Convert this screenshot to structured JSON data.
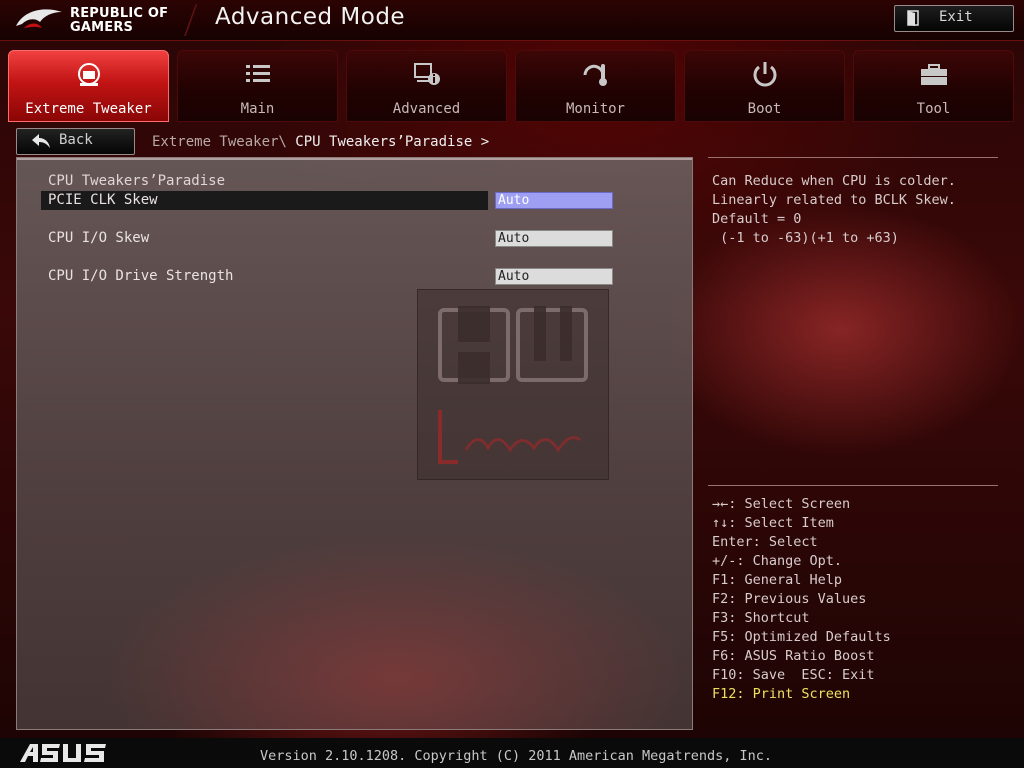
{
  "header": {
    "brand_line1": "REPUBLIC OF",
    "brand_line2": "GAMERS",
    "title": "Advanced Mode",
    "exit_label": "Exit"
  },
  "tabs": [
    {
      "label": "Extreme Tweaker",
      "icon": "tweaker-icon",
      "active": true
    },
    {
      "label": "Main",
      "icon": "list-icon",
      "active": false
    },
    {
      "label": "Advanced",
      "icon": "advanced-icon",
      "active": false
    },
    {
      "label": "Monitor",
      "icon": "monitor-icon",
      "active": false
    },
    {
      "label": "Boot",
      "icon": "power-icon",
      "active": false
    },
    {
      "label": "Tool",
      "icon": "toolbox-icon",
      "active": false
    }
  ],
  "nav": {
    "back_label": "Back",
    "breadcrumb_parent": "Extreme Tweaker\\ ",
    "breadcrumb_current": "CPU Tweakers’Paradise >"
  },
  "main": {
    "section_title": "CPU Tweakers’Paradise",
    "settings": [
      {
        "label": "PCIE CLK Skew",
        "value": "Auto",
        "selected": true
      },
      {
        "label": "CPU I/O Skew",
        "value": "Auto",
        "selected": false
      },
      {
        "label": "CPU I/O Drive Strength",
        "value": "Auto",
        "selected": false
      }
    ]
  },
  "help": {
    "lines": [
      "Can Reduce when CPU is colder.",
      "Linearly related to BCLK Skew.",
      "Default = 0",
      " (-1 to -63)(+1 to +63)"
    ]
  },
  "keys": [
    "→←: Select Screen",
    "↑↓: Select Item",
    "Enter: Select",
    "+/-: Change Opt.",
    "F1: General Help",
    "F2: Previous Values",
    "F3: Shortcut",
    "F5: Optimized Defaults",
    "F6: ASUS Ratio Boost",
    "F10: Save  ESC: Exit",
    "F12: Print Screen"
  ],
  "footer": {
    "logo": "ASUS",
    "version": "Version 2.10.1208. Copyright (C) 2011 American Megatrends, Inc."
  },
  "colors": {
    "accent_red": "#c21414",
    "selected_value": "#9e9ef2",
    "highlight_key": "#f0e060"
  }
}
